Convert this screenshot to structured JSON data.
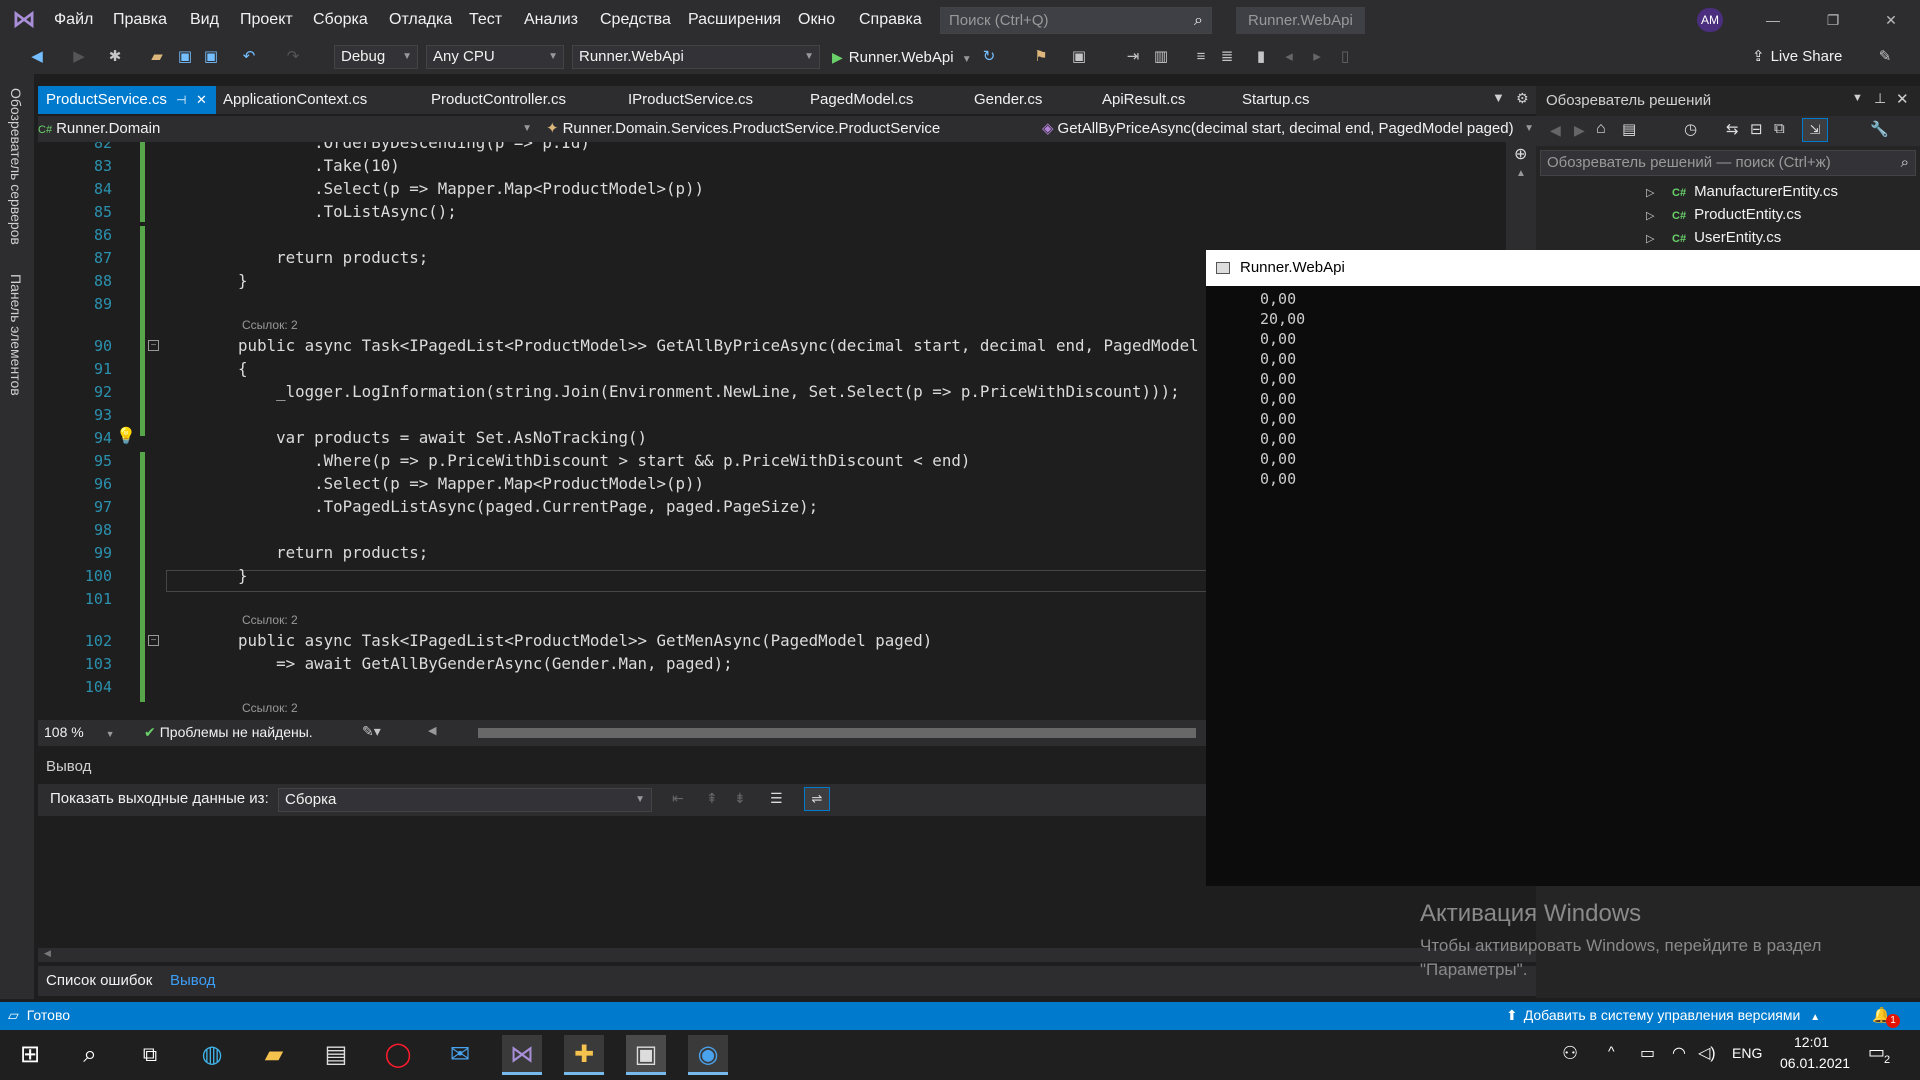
{
  "menu": {
    "items": [
      "Файл",
      "Правка",
      "Вид",
      "Проект",
      "Сборка",
      "Отладка",
      "Тест",
      "Анализ",
      "Средства",
      "Расширения",
      "Окно",
      "Справка"
    ],
    "search_placeholder": "Поиск (Ctrl+Q)",
    "solution_name": "Runner.WebApi",
    "avatar_initials": "AM"
  },
  "toolbar": {
    "configuration": "Debug",
    "platform": "Any CPU",
    "startup_project": "Runner.WebApi",
    "run_label": "Runner.WebApi",
    "live_share_label": "Live Share"
  },
  "left_strip": {
    "server_explorer": "Обозреватель серверов",
    "toolbox": "Панель элементов"
  },
  "doc_tabs": [
    {
      "label": "ProductService.cs",
      "active": true
    },
    {
      "label": "ApplicationContext.cs",
      "active": false
    },
    {
      "label": "ProductController.cs",
      "active": false
    },
    {
      "label": "IProductService.cs",
      "active": false
    },
    {
      "label": "PagedModel.cs",
      "active": false
    },
    {
      "label": "Gender.cs",
      "active": false
    },
    {
      "label": "ApiResult.cs",
      "active": false
    },
    {
      "label": "Startup.cs",
      "active": false
    }
  ],
  "navbar": {
    "project": "Runner.Domain",
    "type": "Runner.Domain.Services.ProductService.ProductService",
    "member": "GetAllByPriceAsync(decimal start, decimal end, PagedModel paged)"
  },
  "editor": {
    "ref_hint": "Ссылок: 2",
    "lines": [
      {
        "n": "82",
        "code": "            .OrderByDescending(p => p.Id)"
      },
      {
        "n": "83",
        "code": "            .Take(10)"
      },
      {
        "n": "84",
        "code": "            .Select(p => Mapper.Map<ProductModel>(p))"
      },
      {
        "n": "85",
        "code": "            .ToListAsync();"
      },
      {
        "n": "86",
        "code": ""
      },
      {
        "n": "87",
        "code": "        return products;"
      },
      {
        "n": "88",
        "code": "    }"
      },
      {
        "n": "89",
        "code": ""
      },
      {
        "n": "90",
        "code": "    public async Task<IPagedList<ProductModel>> GetAllByPriceAsync(decimal start, decimal end, PagedModel paged)"
      },
      {
        "n": "91",
        "code": "    {"
      },
      {
        "n": "92",
        "code": "        _logger.LogInformation(string.Join(Environment.NewLine, Set.Select(p => p.PriceWithDiscount)));"
      },
      {
        "n": "93",
        "code": ""
      },
      {
        "n": "94",
        "code": "        var products = await Set.AsNoTracking()"
      },
      {
        "n": "95",
        "code": "            .Where(p => p.PriceWithDiscount > start && p.PriceWithDiscount < end)"
      },
      {
        "n": "96",
        "code": "            .Select(p => Mapper.Map<ProductModel>(p))"
      },
      {
        "n": "97",
        "code": "            .ToPagedListAsync(paged.CurrentPage, paged.PageSize);"
      },
      {
        "n": "98",
        "code": ""
      },
      {
        "n": "99",
        "code": "        return products;"
      },
      {
        "n": "100",
        "code": "    }"
      },
      {
        "n": "101",
        "code": ""
      },
      {
        "n": "102",
        "code": "    public async Task<IPagedList<ProductModel>> GetMenAsync(PagedModel paged)"
      },
      {
        "n": "103",
        "code": "        => await GetAllByGenderAsync(Gender.Man, paged);"
      },
      {
        "n": "104",
        "code": ""
      }
    ]
  },
  "editor_status": {
    "zoom": "108 %",
    "problems": "Проблемы не найдены."
  },
  "output": {
    "title": "Вывод",
    "show_from_label": "Показать выходные данные из:",
    "source": "Сборка"
  },
  "bottom_tabs": {
    "errors": "Список ошибок",
    "output": "Вывод"
  },
  "solution_explorer": {
    "title": "Обозреватель решений",
    "search_placeholder": "Обозреватель решений — поиск (Ctrl+ж)",
    "items": [
      "ManufacturerEntity.cs",
      "ProductEntity.cs",
      "UserEntity.cs"
    ]
  },
  "console": {
    "title": "Runner.WebApi",
    "lines": [
      "0,00",
      "20,00",
      "0,00",
      "0,00",
      "0,00",
      "0,00",
      "0,00",
      "0,00",
      "0,00",
      "0,00"
    ]
  },
  "watermark": {
    "title": "Активация Windows",
    "text": "Чтобы активировать Windows, перейдите в раздел \"Параметры\"."
  },
  "statusbar": {
    "ready": "Готово",
    "source_control": "Добавить в систему управления версиями",
    "notifications": "1"
  },
  "taskbar": {
    "lang": "ENG",
    "time": "12:01",
    "date": "06.01.2021",
    "notif_count": "2"
  },
  "colors": {
    "accent": "#007acc",
    "background": "#1e1e1e",
    "chrome": "#2d2d30"
  }
}
